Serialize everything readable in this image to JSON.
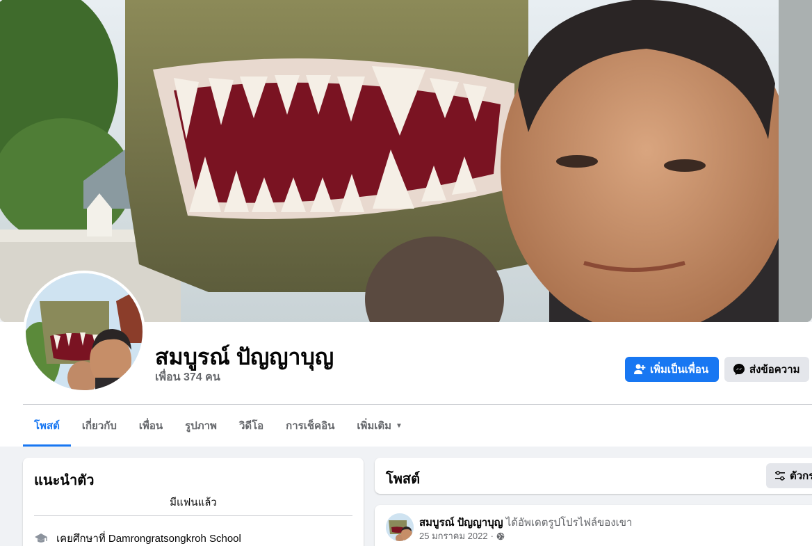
{
  "profile": {
    "name": "สมบูรณ์ ปัญญาบุญ",
    "friends": "เพื่อน 374 คน"
  },
  "actions": {
    "add_friend": "เพิ่มเป็นเพื่อน",
    "message": "ส่งข้อความ"
  },
  "tabs": [
    {
      "label": "โพสต์",
      "active": true
    },
    {
      "label": "เกี่ยวกับ"
    },
    {
      "label": "เพื่อน"
    },
    {
      "label": "รูปภาพ"
    },
    {
      "label": "วิดีโอ"
    },
    {
      "label": "การเช็คอิน"
    },
    {
      "label": "เพิ่มเติม"
    }
  ],
  "intro": {
    "title": "แนะนำตัว",
    "relationship": "มีแฟนแล้ว",
    "education": "เคยศึกษาที่ Damrongratsongkroh School"
  },
  "posts": {
    "title": "โพสต์",
    "filter_label": "ตัวกรอง"
  },
  "post": {
    "author": "สมบูรณ์ ปัญญาบุญ",
    "action": "ได้อัพเดตรูปโปรไฟล์ของเขา",
    "date": "25 มกราคม 2022",
    "separator": "·"
  },
  "colors": {
    "accent": "#1877f2",
    "background": "#f0f2f5",
    "secondary_text": "#65676b"
  }
}
